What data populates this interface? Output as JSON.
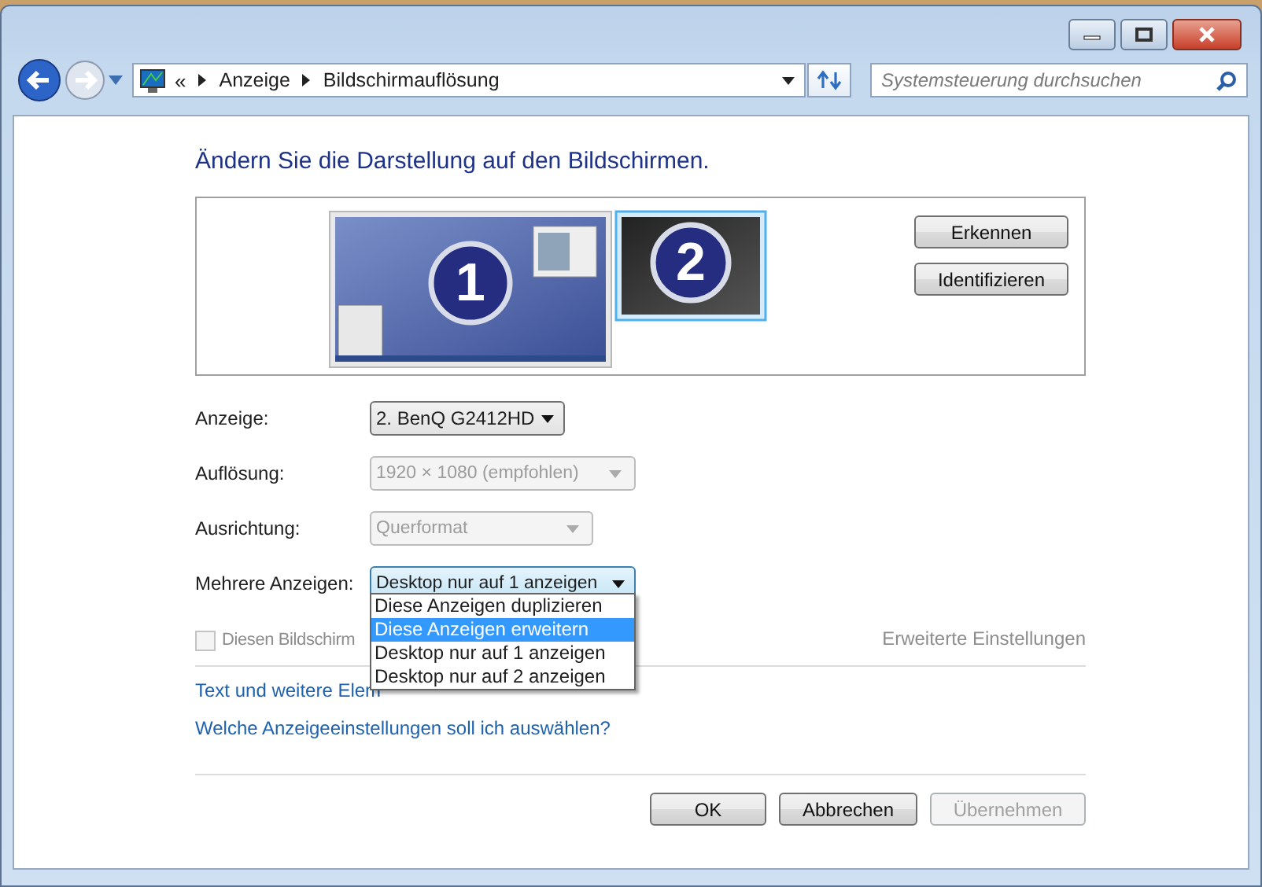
{
  "address_bar": {
    "overflow": "«",
    "breadcrumbs": [
      "Anzeige",
      "Bildschirmauflösung"
    ]
  },
  "search": {
    "placeholder": "Systemsteuerung durchsuchen"
  },
  "heading": "Ändern Sie die Darstellung auf den Bildschirmen.",
  "monitors": [
    {
      "label": "1",
      "selected": false
    },
    {
      "label": "2",
      "selected": true
    }
  ],
  "monitor_buttons": [
    "Erkennen",
    "Identifizieren"
  ],
  "settings": [
    {
      "label": "Anzeige:",
      "value": "2. BenQ G2412HD",
      "disabled": false,
      "open": false
    },
    {
      "label": "Auflösung:",
      "value": "1920 × 1080 (empfohlen)",
      "disabled": true,
      "open": false
    },
    {
      "label": "Ausrichtung:",
      "value": "Querformat",
      "disabled": true,
      "open": false
    },
    {
      "label": "Mehrere Anzeigen:",
      "value": "Desktop nur auf 1 anzeigen",
      "disabled": false,
      "open": true
    }
  ],
  "dropdown_options": [
    {
      "label": "Diese Anzeigen duplizieren",
      "selected": false
    },
    {
      "label": "Diese Anzeigen erweitern",
      "selected": true
    },
    {
      "label": "Desktop nur auf 1 anzeigen",
      "selected": false
    },
    {
      "label": "Desktop nur auf 2 anzeigen",
      "selected": false
    }
  ],
  "main_display_checkbox": {
    "label": "Diesen Bildschirm",
    "checked": false,
    "disabled": true
  },
  "advanced_link": {
    "label": "Erweiterte Einstellungen",
    "disabled": true
  },
  "links": [
    "Text und weitere Elem",
    "Welche Anzeigeeinstellungen soll ich auswählen?"
  ],
  "buttons": [
    {
      "label": "OK",
      "disabled": false
    },
    {
      "label": "Abbrechen",
      "disabled": false
    },
    {
      "label": "Übernehmen",
      "disabled": true
    }
  ]
}
